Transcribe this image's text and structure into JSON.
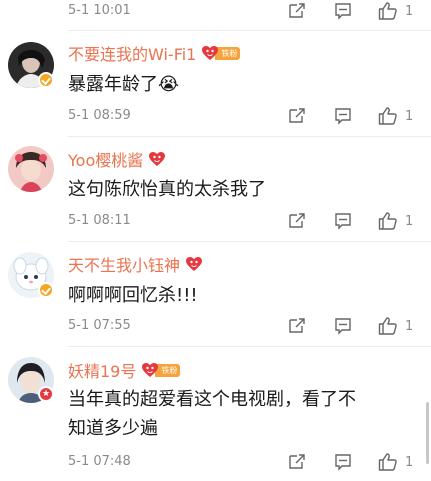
{
  "top_comment": {
    "time": "5-1 10:01",
    "likes": "1"
  },
  "comments": [
    {
      "username": "不要连我的Wi-Fi1",
      "badge_label": "铁粉",
      "text": "暴露年龄了😭",
      "time": "5-1 08:59",
      "likes": "1"
    },
    {
      "username": "Yoo樱桃酱",
      "badge_label": "",
      "text": "这句陈欣怡真的太杀我了",
      "time": "5-1 08:11",
      "likes": "1"
    },
    {
      "username": "天不生我小钰神",
      "badge_label": "",
      "text": "啊啊啊回忆杀!!!",
      "time": "5-1 07:55",
      "likes": "1"
    },
    {
      "username": "妖精19号",
      "badge_label": "铁粉",
      "text_line1": "当年真的超爱看这个电视剧，看了不",
      "text_line2": "知道多少遍",
      "time": "5-1 07:48",
      "likes": "1"
    }
  ],
  "colors": {
    "username": "#eb7350",
    "meta": "#8a8a8a",
    "badge_orange": "#f7a33b",
    "heart_red": "#e6393f",
    "verified_badge": "#f5a623"
  },
  "icons": [
    "share-icon",
    "comment-icon",
    "like-icon",
    "fan-heart-icon",
    "verified-badge-icon"
  ]
}
